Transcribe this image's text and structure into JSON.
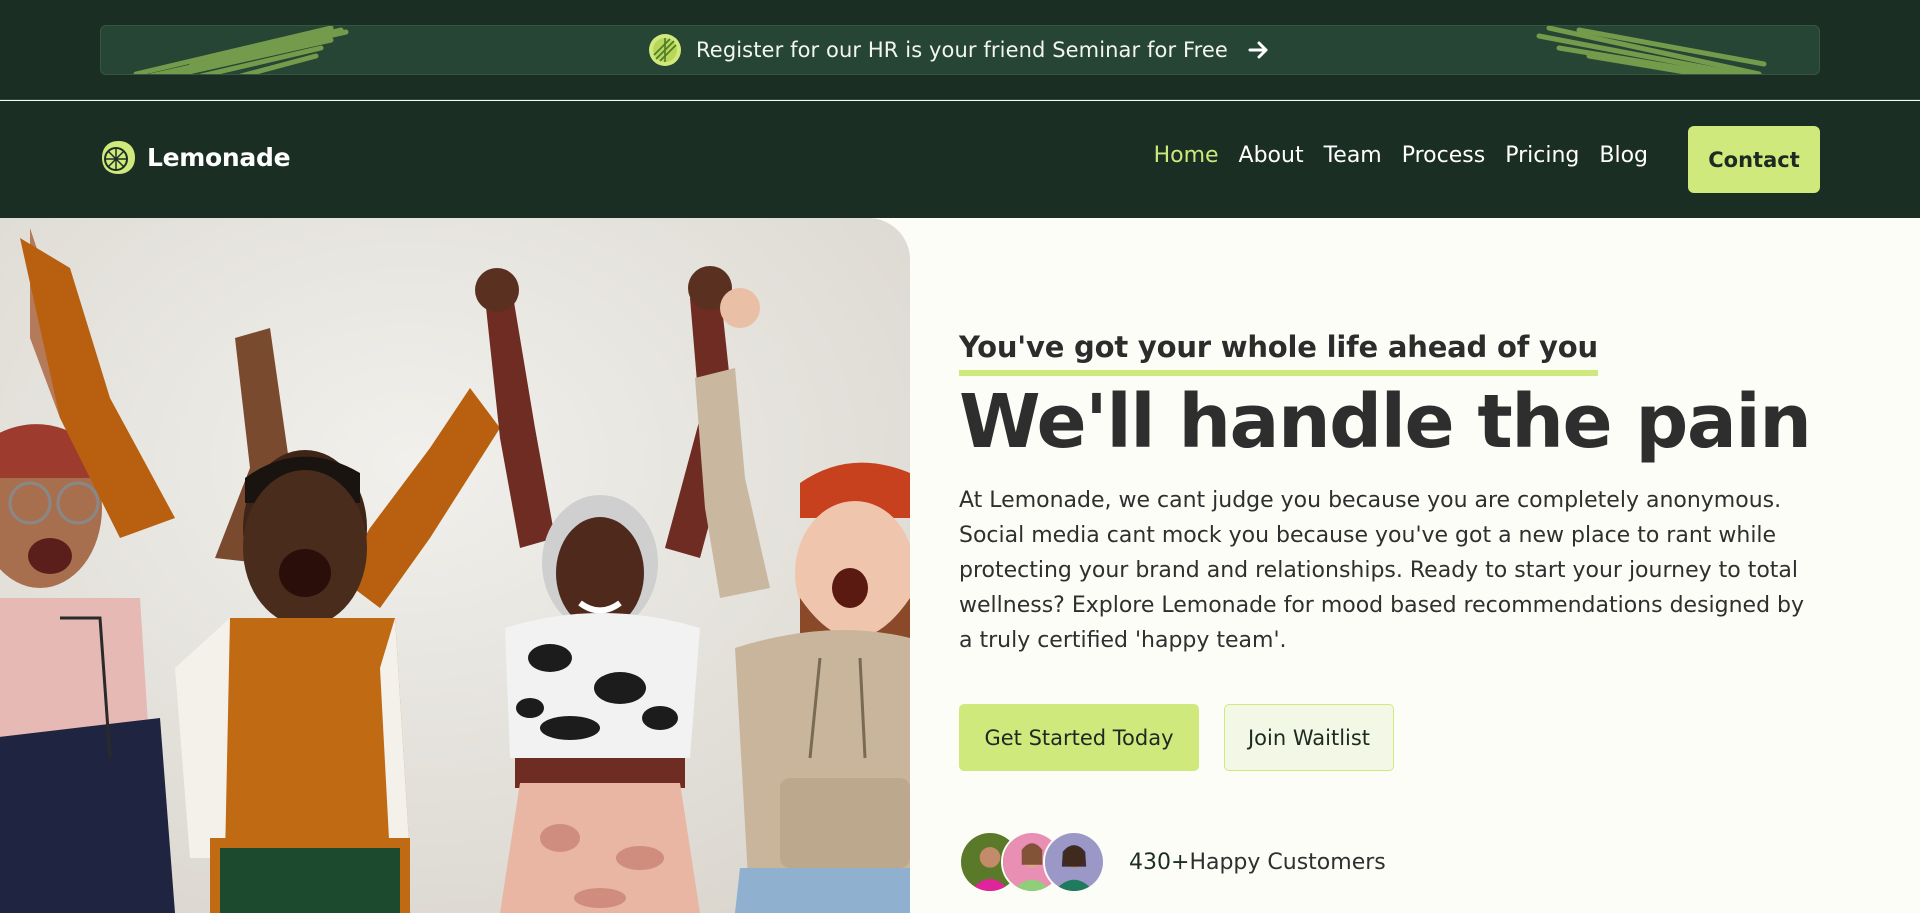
{
  "banner": {
    "text": "Register for our HR is your friend Seminar for Free",
    "icon": "lemon-slice-icon",
    "arrow_icon": "arrow-right-icon"
  },
  "nav": {
    "logo_text": "Lemonade",
    "logo_icon": "lemon-icon",
    "links": [
      {
        "label": "Home",
        "active": true
      },
      {
        "label": "About",
        "active": false
      },
      {
        "label": "Team",
        "active": false
      },
      {
        "label": "Process",
        "active": false
      },
      {
        "label": "Pricing",
        "active": false
      },
      {
        "label": "Blog",
        "active": false
      }
    ],
    "contact_label": "Contact"
  },
  "hero": {
    "eyebrow": "You've got your whole life ahead of you",
    "headline": "We'll handle the pain",
    "body": "At Lemonade, we cant judge you because you are completely anonymous. Social media cant mock you because you've got a new place to rant while protecting your brand and relationships. Ready to start your journey to total wellness? Explore Lemonade for mood based recommendations designed by a truly certified 'happy team'.",
    "primary_cta": "Get Started Today",
    "secondary_cta": "Join Waitlist",
    "customers_count": "430+",
    "customers_label": "Happy Customers"
  },
  "colors": {
    "dark_green": "#1b2e24",
    "lime_accent": "#cfe97c",
    "page_background": "#fcfdf6"
  }
}
